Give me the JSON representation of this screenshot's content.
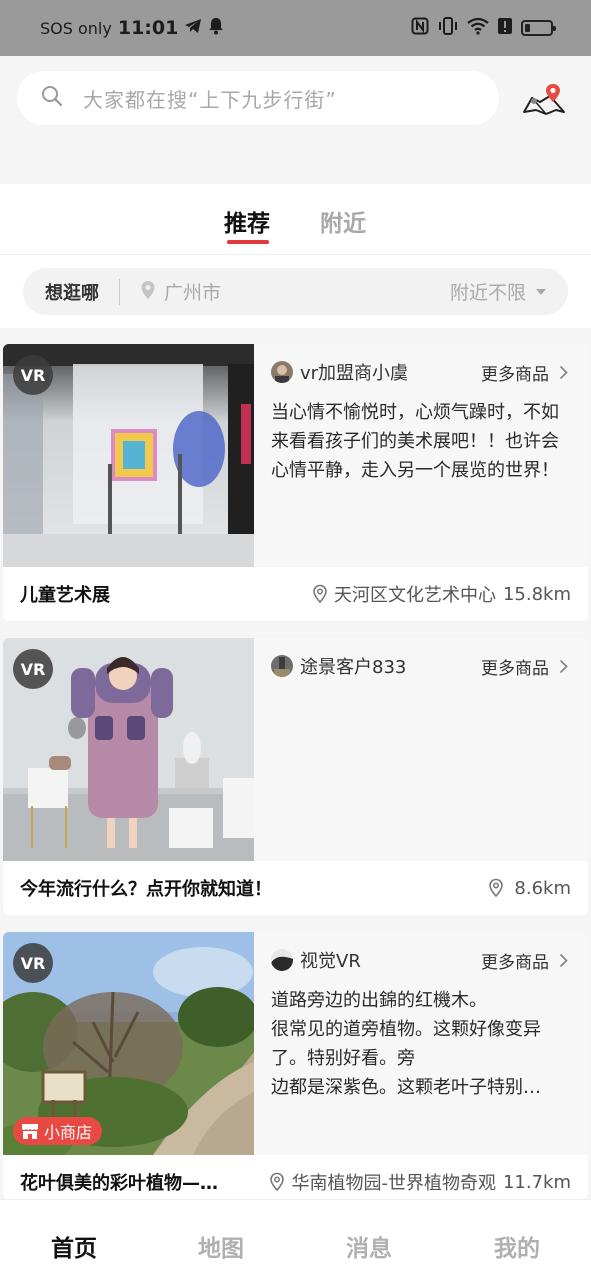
{
  "status_bar": {
    "carrier": "SOS only",
    "time": "11:01",
    "battery_level": 0.2,
    "icons": [
      "telegram-icon",
      "bell-icon",
      "nfc-icon",
      "vibrate-icon",
      "wifi-icon",
      "alert-icon",
      "battery-icon"
    ]
  },
  "header": {
    "search_placeholder": "大家都在搜“上下九步行街”",
    "icons": [
      "search-icon",
      "map-pin-icon"
    ],
    "accent_color": "#e03a3a"
  },
  "tabs": {
    "items": [
      {
        "label": "推荐",
        "active": true
      },
      {
        "label": "附近",
        "active": false
      }
    ]
  },
  "filter": {
    "label": "想逛哪",
    "city": "广州市",
    "distance": "附近不限"
  },
  "cards": [
    {
      "badge": "VR",
      "merchant": "vr加盟商小虞",
      "more": "更多商品",
      "description": "当心情不愉悦时，心烦气躁时，不如来看看孩子们的美术展吧！！也许会心情平静，走入另一个展览的世界！",
      "title": "儿童艺术展",
      "location": "天河区文化艺术中心",
      "distance": "15.8km"
    },
    {
      "badge": "VR",
      "merchant": "途景客户833",
      "more": "更多商品",
      "description": "",
      "title": "今年流行什么？点开你就知道！",
      "location": "",
      "distance": "8.6km"
    },
    {
      "badge": "VR",
      "shop_badge": "小商店",
      "merchant": "视觉VR",
      "more": "更多商品",
      "description": "道路旁边的出錦的红機木。\n很常见的道旁植物。这颗好像变异了。特别好看。旁\n边都是深紫色。这颗老叶子特别…",
      "title": "花叶俱美的彩叶植物—…",
      "location": "华南植物园-世界植物奇观",
      "distance": "11.7km"
    }
  ],
  "bottom_nav": [
    {
      "label": "首页",
      "active": true
    },
    {
      "label": "地图",
      "active": false
    },
    {
      "label": "消息",
      "active": false
    },
    {
      "label": "我的",
      "active": false
    }
  ]
}
